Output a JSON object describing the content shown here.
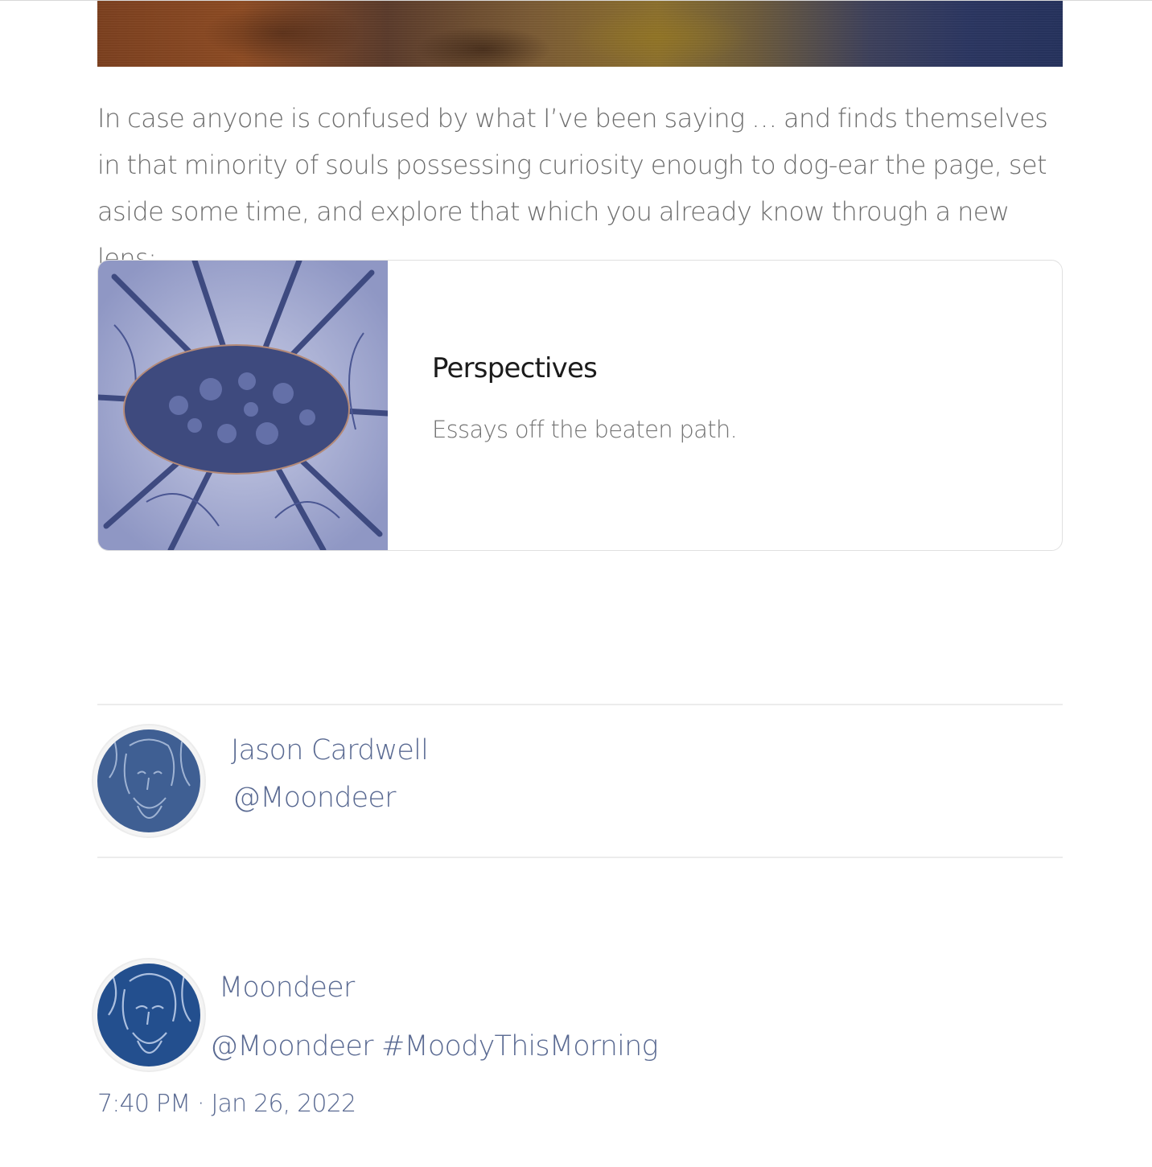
{
  "intro": {
    "text": "In case anyone is confused by what I’ve been saying … and finds themselves in that minority of souls possessing curiosity enough to dog-ear the page, set aside some time, and explore that which you already know through a new lens:"
  },
  "embed": {
    "title": "Perspectives",
    "description": "Essays off the beaten path."
  },
  "author": {
    "name": "Jason Cardwell",
    "handle": "@Moondeer"
  },
  "tweet": {
    "name": "Moondeer",
    "text": "@Moondeer #MoodyThisMorning",
    "time": "7:40 PM · Jan 26, 2022"
  },
  "colors": {
    "link": "#5a6a92",
    "body_text": "#6d6d6d",
    "card_border": "#e0e0e0"
  }
}
